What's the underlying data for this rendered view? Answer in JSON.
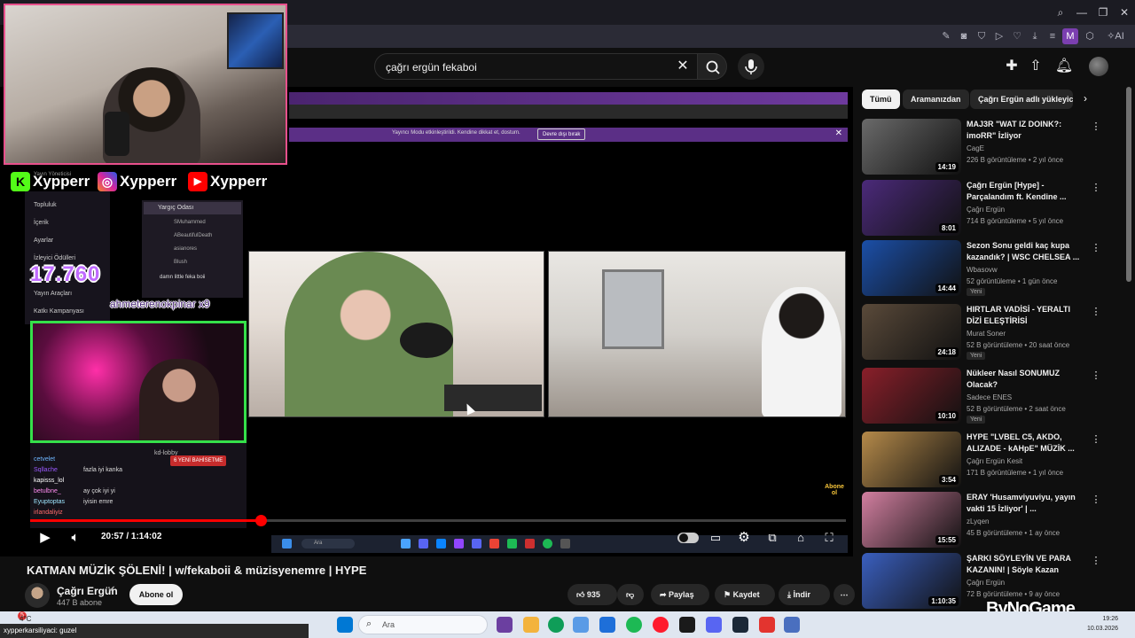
{
  "browser": {
    "extension_letter": "M",
    "ai_label": "AI"
  },
  "search": {
    "value": "çağrı ergün fekaboi"
  },
  "stream_overlay": {
    "social_handles": [
      {
        "platform": "kick",
        "logo": "K",
        "handle": "Xypperr",
        "color": "#53fc18"
      },
      {
        "platform": "instagram",
        "logo": "◎",
        "handle": "Xypperr",
        "color": "#d6249f"
      },
      {
        "platform": "youtube",
        "logo": "▶",
        "handle": "Xypperr",
        "color": "#ff0000"
      }
    ],
    "viewer_count": "17.760",
    "sub_message": "ahmeterenokpinar x9",
    "mod_banner": "Yayıncı Modu etkinleştirildi. Kendine dikkat et, dostum.",
    "mod_button": "Devre dışı bırak",
    "left_menu": [
      "Yayın Yöneticisi",
      "Topluluk",
      "İçerik",
      "Ayarlar",
      "İzleyici Ödülleri",
      "Yayın Araçları",
      "Katkı Kampanyası"
    ],
    "chat_room": "Yargıç Odası",
    "chat_users": [
      "SMuhammed",
      "ABeautifulDeath",
      "asianores",
      "Blush"
    ],
    "chat_pinned": "damn little feka boii",
    "chat_lines": [
      {
        "user": "cetvelet",
        "text": "",
        "color": "#6fb6ff"
      },
      {
        "user": "Sqllache",
        "text": "fazla iyi kanka",
        "color": "#9b59ff"
      },
      {
        "user": "kapisss_lol",
        "text": "",
        "color": "#ffffff"
      },
      {
        "user": "betulbne_",
        "text": "ay çok iyi yi",
        "color": "#ff8cf0"
      },
      {
        "user": "Eyuptoptas",
        "text": "iyisin emre",
        "color": "#9ee6ff"
      },
      {
        "user": "irlandaliyiz",
        "text": "",
        "color": "#ff6b6b"
      }
    ],
    "hype_badge": "6 YENİ BAHİSETME",
    "voice_channel": "kd-lobby",
    "abone_badge": "Abone ol",
    "bottom_chat": "ses be abla efsane booo!",
    "inner_search": "Ara"
  },
  "player": {
    "time": "20:57 / 1:14:02",
    "progress": 0.283
  },
  "video": {
    "title": "KATMAN MÜZİK ŞÖLENİ! | w/fekaboii & müzisyenemre | HYPE",
    "channel": "Çağrı Ergün",
    "subscribers": "447 B abone",
    "subscribe_label": "Abone ol",
    "likes": "935",
    "share_label": "Paylaş",
    "save_label": "Kaydet",
    "download_label": "İndir"
  },
  "chips": [
    "Tümü",
    "Aramanızdan",
    "Çağrı Ergün adlı yükleyici"
  ],
  "recommendations": [
    {
      "title": "MAJ3R \"WAT IZ DOINK?: imoRR\" İzliyor",
      "channel": "CagE",
      "meta": "226 B görüntüleme • 2 yıl önce",
      "duration": "14:19",
      "new": "",
      "thumb": "#6a6a6a"
    },
    {
      "title": "Çağrı Ergün [Hype] - Parçalandım ft. Kendine ...",
      "channel": "Çağrı Ergün",
      "meta": "714 B görüntüleme • 5 yıl önce",
      "duration": "8:01",
      "new": "",
      "thumb": "#4b2a7a"
    },
    {
      "title": "Sezon Sonu geldi kaç kupa kazandık? | WSC CHELSEA ...",
      "channel": "Wbasovw",
      "meta": "52 görüntüleme • 1 gün önce",
      "duration": "14:44",
      "new": "Yeni",
      "thumb": "#1b4fa8"
    },
    {
      "title": "HIRTLAR VADİSİ - YERALTI DİZİ ELEŞTİRİSİ",
      "channel": "Murat Soner",
      "meta": "52 B görüntüleme • 20 saat önce",
      "duration": "24:18",
      "new": "Yeni",
      "thumb": "#5a4a3a"
    },
    {
      "title": "Nükleer Nasıl SONUMUZ Olacak?",
      "channel": "Sadece ENES",
      "meta": "52 B görüntüleme • 2 saat önce",
      "duration": "10:10",
      "new": "Yeni",
      "thumb": "#8a1f2a"
    },
    {
      "title": "HYPE \"LVBEL C5, AKDO, ALIZADE - kAHpE\" MÜZİK ...",
      "channel": "Çağrı Ergün Kesit",
      "meta": "171 B görüntüleme • 1 yıl önce",
      "duration": "3:54",
      "new": "",
      "thumb": "#b58a4a"
    },
    {
      "title": "ERAY 'Husamviyuviyu, yayın vakti 15 İzliyor' | ...",
      "channel": "zLyqen",
      "meta": "45 B görüntüleme • 1 ay önce",
      "duration": "15:55",
      "new": "",
      "thumb": "#d27fa0"
    },
    {
      "title": "ŞARKI SÖYLEYİN VE PARA KAZANIN! | Söyle Kazan",
      "channel": "Çağrı Ergün",
      "meta": "72 B görüntüleme • 9 ay önce",
      "duration": "1:10:35",
      "new": "",
      "thumb": "#3a5fbf"
    }
  ],
  "taskbar": {
    "weather": "4°C",
    "notification_count": "5",
    "search_placeholder": "Ara",
    "time": "19:26",
    "date": "10.03.2026",
    "chat_strip": "xypperkarsiliyaci: guzel"
  },
  "watermark": "ByNoGame"
}
